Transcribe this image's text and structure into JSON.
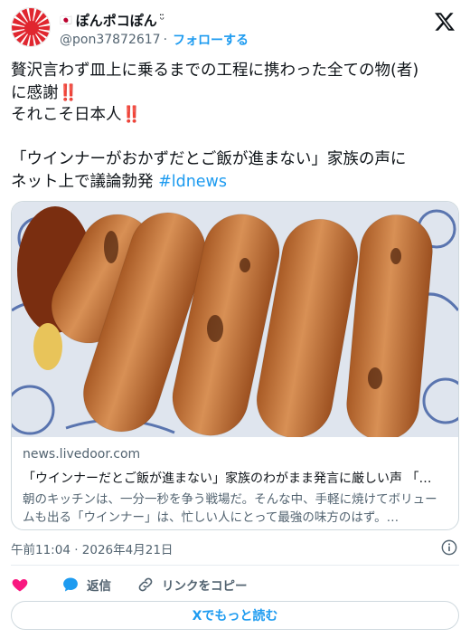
{
  "user": {
    "flag": "🇯🇵",
    "display_name": "ぽんポコぽん",
    "name_suffix": "ᵕ̈",
    "handle": "@pon37872617",
    "separator": "·",
    "follow_label": "フォローする"
  },
  "tweet": {
    "line1": "贅沢言わず皿上に乗るまでの工程に携わった全ての物(者)",
    "line2": "に感謝‼️",
    "line3": "それこそ日本人‼️",
    "line4": "「ウインナーがおかずだとご飯が進まない」家族の声に",
    "line5": "ネット上で議論勃発 ",
    "hashtag": "#ldnews"
  },
  "card": {
    "domain": "news.livedoor.com",
    "title": "「ウインナーだとご飯が進まない」家族のわがまま発言に厳しい声 「…",
    "description": "朝のキッチンは、一分一秒を争う戦場だ。そんな中、手軽に焼けてボリュームも出る「ウインナー」は、忙しい人にとって最強の味方のはず。…"
  },
  "timestamp": "午前11:04 · 2026年4月21日",
  "actions": {
    "like_label": "",
    "reply_label": "返信",
    "copy_link_label": "リンクをコピー"
  },
  "read_more_label": "Xでもっと読む",
  "colors": {
    "accent": "#1d9bf0",
    "like": "#f91880",
    "text": "#0f1419",
    "muted": "#536471"
  }
}
